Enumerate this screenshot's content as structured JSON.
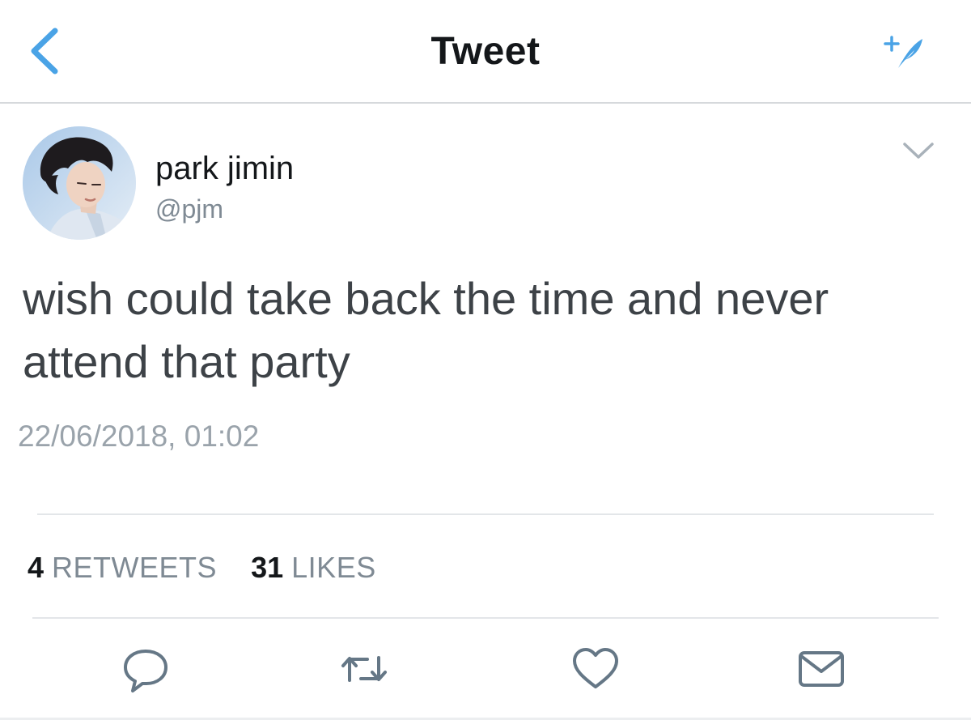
{
  "header": {
    "title": "Tweet",
    "back_icon": "chevron-left-icon",
    "compose_icon": "feather-sparkle-icon"
  },
  "tweet": {
    "author": {
      "display_name": "park jimin",
      "handle": "@pjm"
    },
    "text": "wish could take back the time and never attend that party",
    "timestamp": "22/06/2018, 01:02",
    "stats": {
      "retweets_count": "4",
      "retweets_label": "RETWEETS",
      "likes_count": "31",
      "likes_label": "LIKES"
    }
  },
  "actions": [
    {
      "name": "reply",
      "icon": "speech-bubble-icon"
    },
    {
      "name": "retweet",
      "icon": "retweet-arrows-icon"
    },
    {
      "name": "like",
      "icon": "heart-icon"
    },
    {
      "name": "direct-message",
      "icon": "envelope-icon"
    }
  ],
  "colors": {
    "accent": "#4aa3e6",
    "text_primary": "#14171a",
    "text_body": "#3d4247",
    "text_secondary": "#7f8a94",
    "icon_gray": "#657786",
    "divider": "#e3e6e9"
  }
}
